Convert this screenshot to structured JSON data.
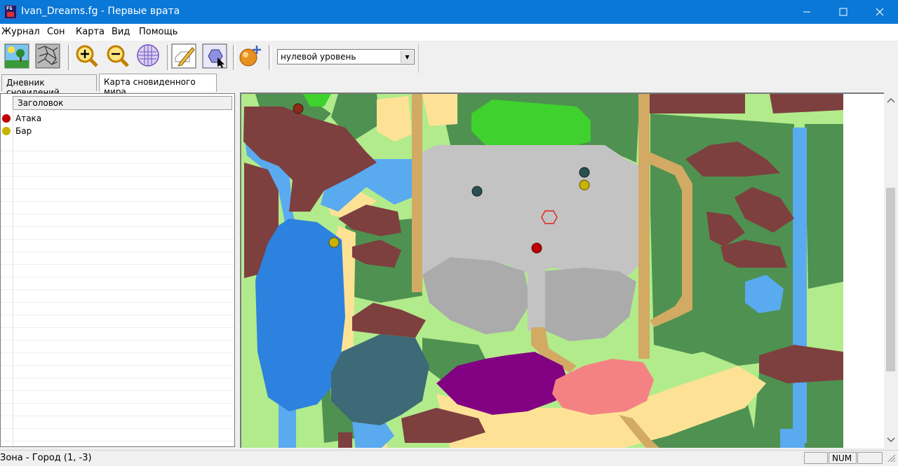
{
  "window": {
    "title": "Ivan_Dreams.fg - Первые врата"
  },
  "menu": [
    "Журнал",
    "Сон",
    "Карта",
    "Вид",
    "Помощь"
  ],
  "toolbar": {
    "level": "нулевой уровень",
    "buttons": [
      "landscape-icon",
      "map-grid-icon",
      "zoom-in-icon",
      "zoom-out-icon",
      "hex-grid-icon",
      "edit-icon",
      "hex-select-icon",
      "add-sphere-icon"
    ]
  },
  "tabs": [
    "Дневник сновидений",
    "Карта сновиденного мира"
  ],
  "list": {
    "column": "Заголовок",
    "items": [
      {
        "label": "Атака",
        "color": "#c00000"
      },
      {
        "label": "Бар",
        "color": "#c8b400"
      }
    ]
  },
  "status": {
    "text": "Зона - Город (1, -3)",
    "num": "NUM"
  },
  "colors": {
    "titlebar": "#0a78d7",
    "land-light": "#b2eb8c",
    "forest": "#4f9150",
    "mountain": "#7e3f3f",
    "water": "#5aaaf0",
    "lake": "#2c82de",
    "sand": "#fde296",
    "road": "#d2aa64",
    "city": "#c3c3c3",
    "grass": "#3fd12d",
    "purple": "#820082",
    "pink": "#f58282"
  }
}
